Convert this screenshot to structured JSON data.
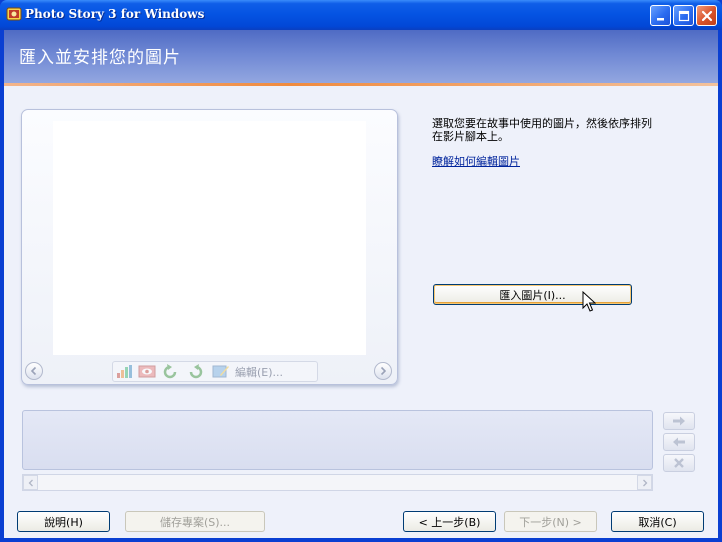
{
  "window": {
    "title": "Photo Story 3 for Windows"
  },
  "page": {
    "title": "匯入並安排您的圖片"
  },
  "instructions": {
    "text_line1": "選取您要在故事中使用的圖片，然後依序排列",
    "text_line2": "在影片腳本上。",
    "help_link": "瞭解如何編輯圖片"
  },
  "import_button": {
    "label": "匯入圖片(I)..."
  },
  "preview": {
    "edit_label": "編輯(E)..."
  },
  "footer": {
    "help_label": "說明(H)",
    "save_label": "儲存專案(S)...",
    "back_label": "< 上一步(B)",
    "next_label": "下一步(N) >",
    "cancel_label": "取消(C)"
  },
  "colors": {
    "titlebar": "#0453e2",
    "header": "#6f88d4",
    "accent_stripe": "#f08b3e",
    "link": "#00249c"
  }
}
